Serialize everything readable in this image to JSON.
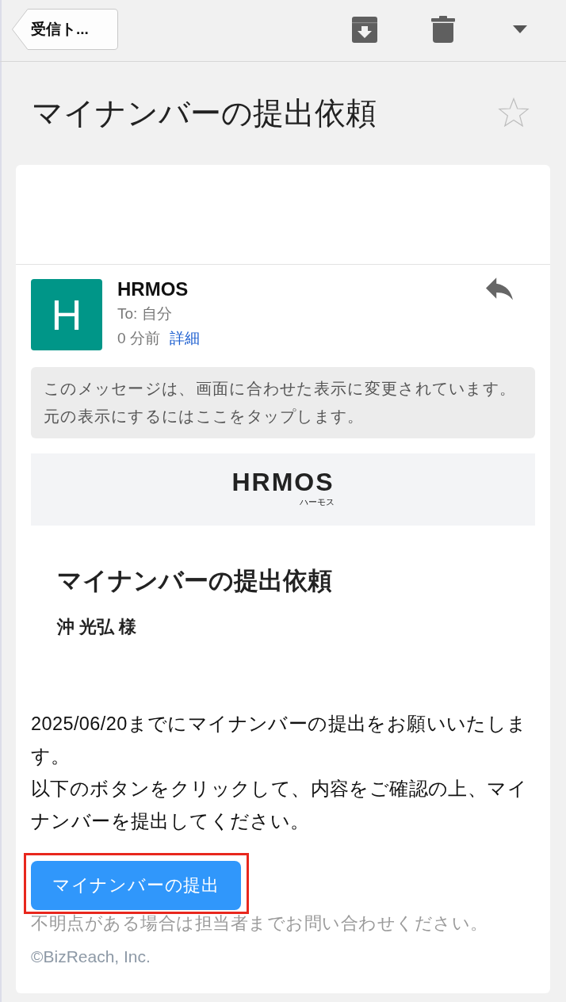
{
  "toolbar": {
    "back_label": "受信ト..."
  },
  "subject": {
    "title": "マイナンバーの提出依頼",
    "starred": false
  },
  "message": {
    "sender": "HRMOS",
    "avatar_letter": "H",
    "recipient": "To: 自分",
    "time": "0 分前",
    "details_link": "詳細",
    "notice": "このメッセージは、画面に合わせた表示に変更されています。元の表示にするにはここをタップします。"
  },
  "email_body": {
    "logo": {
      "wordmark": "HRMOS",
      "reading": "ハーモス"
    },
    "heading": "マイナンバーの提出依頼",
    "addressee": "沖 光弘 様",
    "paragraphs": [
      "2025/06/20までにマイナンバーの提出をお願いいたします。",
      "以下のボタンをクリックして、内容をご確認の上、マイナンバーを提出してください。"
    ],
    "cta_button": {
      "label": "マイナンバーの提出",
      "highlighted": true
    },
    "note": "不明点がある場合は担当者までお問い合わせください。",
    "copyright": "©BizReach, Inc."
  }
}
